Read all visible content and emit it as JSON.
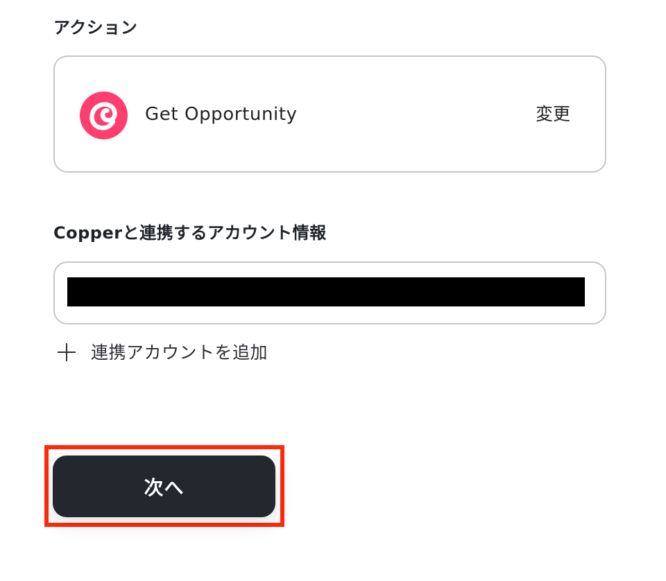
{
  "action_section": {
    "label": "アクション",
    "app_icon": "copper-logo-icon",
    "action_name": "Get Opportunity",
    "change_label": "変更"
  },
  "account_section": {
    "label": "Copperと連携するアカウント情報",
    "value": ""
  },
  "add_account": {
    "icon": "plus-icon",
    "label": "連携アカウントを追加"
  },
  "next_button": {
    "label": "次へ"
  },
  "colors": {
    "brand_copper": "#ff3d6e",
    "button_dark": "#23272e",
    "highlight": "#ff2a0a",
    "border": "#c2c7cc"
  }
}
